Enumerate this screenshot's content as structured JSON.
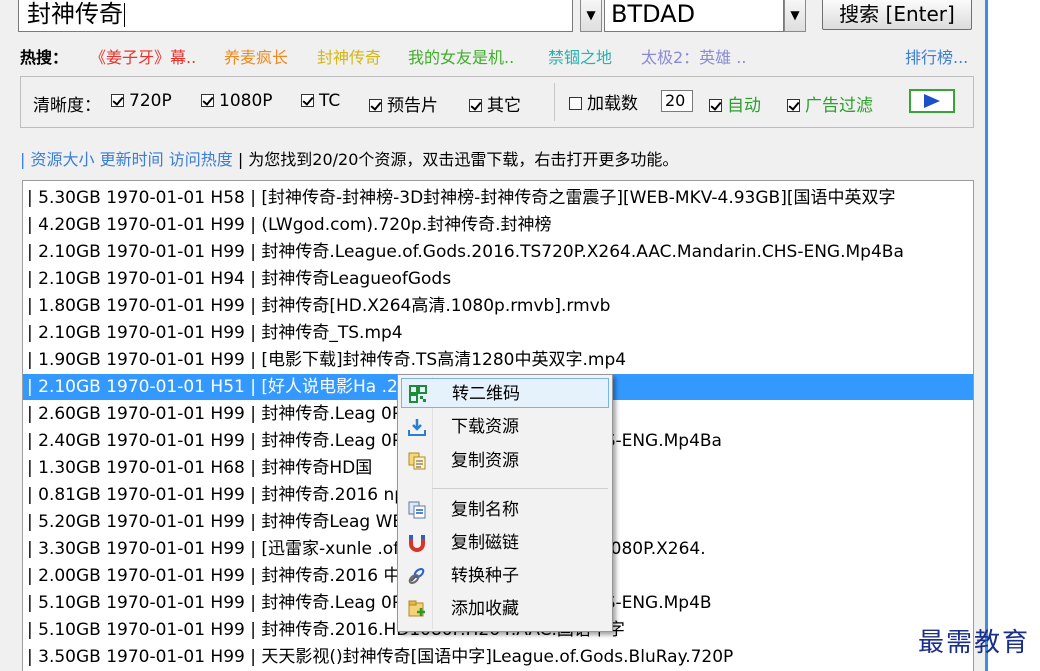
{
  "search": {
    "query": "封神传奇",
    "source": "BTDAD",
    "button_label": "搜索 [Enter]"
  },
  "hot": {
    "label": "热搜：",
    "items": [
      {
        "text": "《姜子牙》幕..",
        "color": "#e8312a"
      },
      {
        "text": "养麦疯长",
        "color": "#f08a1c"
      },
      {
        "text": "封神传奇",
        "color": "#d6b612"
      },
      {
        "text": "我的女友是机..",
        "color": "#3fae2a"
      },
      {
        "text": "禁锢之地",
        "color": "#2ab0b0"
      },
      {
        "text": "太极2：英雄 ..",
        "color": "#8a8ad8"
      }
    ],
    "ranking_link": "排行榜..."
  },
  "options": {
    "clarity_label": "清晰度：",
    "filters": [
      {
        "label": "720P",
        "checked": true
      },
      {
        "label": "1080P",
        "checked": true
      },
      {
        "label": "TC",
        "checked": true
      },
      {
        "label": "预告片",
        "checked": true
      },
      {
        "label": "其它",
        "checked": true
      }
    ],
    "load_count_label": "加载数",
    "load_count_checked": false,
    "load_count_value": "20",
    "auto_label": "自动",
    "auto_checked": true,
    "ad_filter_label": "广告过滤",
    "ad_filter_checked": true,
    "green": "#2aa02a"
  },
  "info": {
    "sort_size": "资源大小",
    "sort_time": "更新时间",
    "sort_hot": "访问热度",
    "message": "| 为您找到20/20个资源，双击迅雷下载，右击打开更多功能。"
  },
  "results": [
    {
      "text": "| 5.30GB 1970-01-01 H58 | [封神传奇-封神榜-3D封神榜-封神传奇之雷震子][WEB-MKV-4.93GB][国语中英双字"
    },
    {
      "text": "| 4.20GB 1970-01-01 H99 | (LWgod.com).720p.封神传奇.封神榜"
    },
    {
      "text": "| 2.10GB 1970-01-01 H99 | 封神传奇.League.of.Gods.2016.TS720P.X264.AAC.Mandarin.CHS-ENG.Mp4Ba"
    },
    {
      "text": "| 2.10GB 1970-01-01 H94 | 封神传奇LeagueofGods"
    },
    {
      "text": "| 1.80GB 1970-01-01 H99 | 封神传奇[HD.X264高清.1080p.rmvb].rmvb"
    },
    {
      "text": "| 2.10GB 1970-01-01 H99 | 封神传奇_TS.mp4"
    },
    {
      "text": "| 1.90GB 1970-01-01 H99 | [电影下载]封神传奇.TS高清1280中英双字.mp4"
    },
    {
      "text": "| 2.10GB 1970-01-01 H51 | [好人说电影Ha                        .2016.TS720P",
      "selected": true
    },
    {
      "text": "| 2.60GB 1970-01-01 H99 | 封神传奇.Leag                         0P.x264.国语中文字幕.rarbt"
    },
    {
      "text": "| 2.40GB 1970-01-01 H99 | 封神传奇.Leag                         0P.X264.AAC.Mandarin.CHS-ENG.Mp4Ba"
    },
    {
      "text": "| 1.30GB 1970-01-01 H68 | 封神传奇HD国"
    },
    {
      "text": "| 0.81GB 1970-01-01 H99 | 封神传奇.2016                         np4"
    },
    {
      "text": "| 5.20GB 1970-01-01 H99 | 封神传奇Leag                          WEB-DLx264AAC"
    },
    {
      "text": "| 3.30GB 1970-01-01 H99 | [迅雷家-xunle                         .of.Gods.中文字幕.2016.HD1080P.X264."
    },
    {
      "text": "| 2.00GB 1970-01-01 H99 | 封神传奇.2016                         中字"
    },
    {
      "text": "| 5.10GB 1970-01-01 H99 | 封神传奇.Leag                         0P.X264.AAC.Mandarin.CHS-ENG.Mp4B"
    },
    {
      "text": "| 5.10GB 1970-01-01 H99 | 封神传奇.2016.HD1080P.H264.AAC.国语中字"
    },
    {
      "text": "| 3.50GB 1970-01-01 H99 | 天天影视()封神传奇[国语中字]League.of.Gods.BluRay.720P"
    }
  ],
  "context_menu": {
    "items": [
      {
        "label": "转二维码",
        "icon": "qr-code-icon"
      },
      {
        "label": "下载资源",
        "icon": "download-icon"
      },
      {
        "label": "复制资源",
        "icon": "copy-resource-icon"
      },
      {
        "label": "复制名称",
        "icon": "copy-name-icon"
      },
      {
        "label": "复制磁链",
        "icon": "magnet-icon"
      },
      {
        "label": "转换种子",
        "icon": "convert-torrent-icon"
      },
      {
        "label": "添加收藏",
        "icon": "add-favorite-icon"
      }
    ]
  },
  "watermark": "最需教育",
  "colors": {
    "selection": "#3399ff",
    "link_blue": "#3a7ed6",
    "window_border": "#3c8ede"
  }
}
